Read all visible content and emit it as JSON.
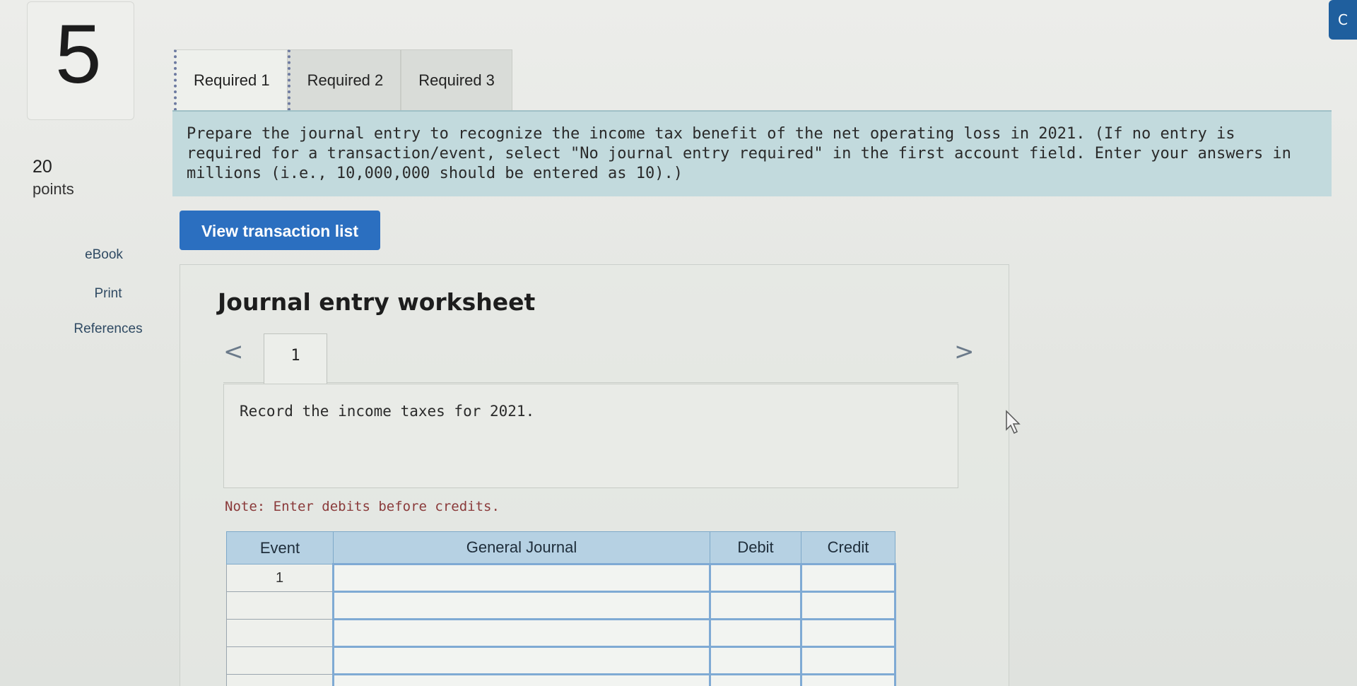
{
  "question": {
    "number": "5",
    "points_value": "20",
    "points_label": "points"
  },
  "side_links": [
    "eBook",
    "Print",
    "References"
  ],
  "corner_button": "C",
  "tabs": [
    {
      "label": "Required 1",
      "active": true
    },
    {
      "label": "Required 2",
      "active": false
    },
    {
      "label": "Required 3",
      "active": false
    }
  ],
  "instructions": "Prepare the journal entry to recognize the income tax benefit of the net operating loss in 2021. (If no entry is required for a transaction/event, select \"No journal entry required\" in the first account field. Enter your answers in millions (i.e., 10,000,000 should be entered as 10).)",
  "view_transaction_button": "View transaction list",
  "worksheet": {
    "title": "Journal entry worksheet",
    "nav_prev": "<",
    "nav_next": ">",
    "current_tab": "1",
    "record_text": "Record the income taxes for 2021.",
    "note": "Note: Enter debits before credits."
  },
  "journal": {
    "headers": [
      "Event",
      "General Journal",
      "Debit",
      "Credit"
    ],
    "rows": [
      {
        "event": "1"
      },
      {
        "event": ""
      },
      {
        "event": ""
      },
      {
        "event": ""
      },
      {
        "event": ""
      }
    ]
  },
  "colors": {
    "accent_button": "#2b6fc0",
    "banner": "#c2dadd",
    "table_header": "#b6d1e3"
  }
}
